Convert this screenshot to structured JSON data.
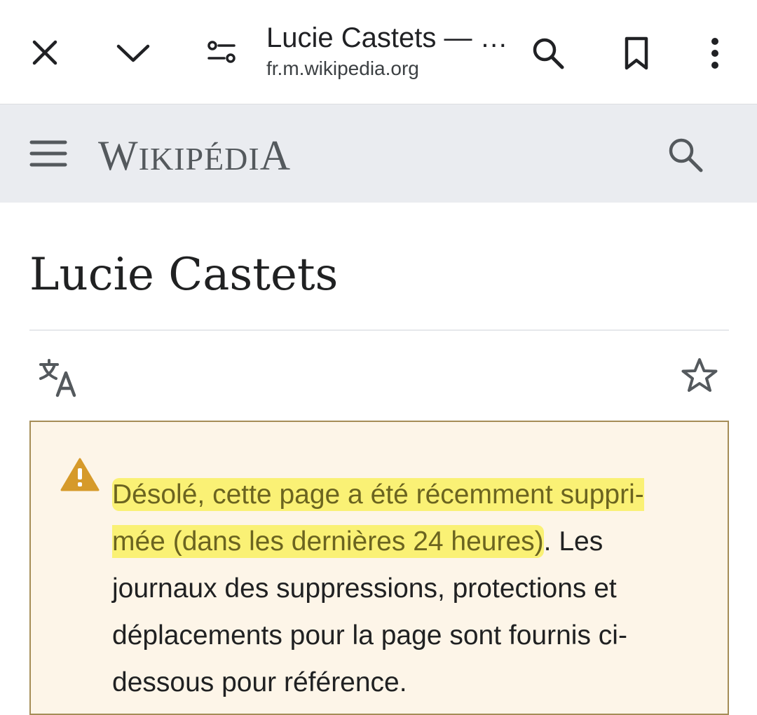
{
  "browser": {
    "title": "Lucie Castets — …",
    "url": "fr.m.wikipedia.org"
  },
  "wiki": {
    "wordmark_initial_w": "W",
    "wordmark_rest_w": "IKIPÉDI",
    "wordmark_final_a": "A"
  },
  "page": {
    "title": "Lucie Castets"
  },
  "notice": {
    "highlighted_text": "Désolé, cette page a été récemment suppri­mée (dans les dernières 24 heures)",
    "rest_text": ". Les journaux des suppressions, protections et déplacements pour la page sont fournis ci-dessous pour référence."
  },
  "colors": {
    "header_bg": "#eaecf0",
    "notice_bg": "#fdf5e8",
    "notice_border": "#a58d57",
    "warning_icon": "#d69a2a",
    "highlight": "#f8ef54"
  }
}
